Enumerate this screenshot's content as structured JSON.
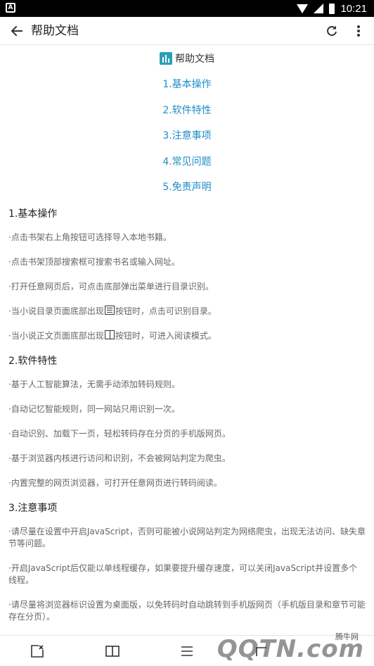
{
  "status_bar": {
    "time": "10:21",
    "left_badge": "A"
  },
  "app_bar": {
    "title": "帮助文档"
  },
  "toc": {
    "title": "帮助文档",
    "items": [
      "1.基本操作",
      "2.软件特性",
      "3.注意事项",
      "4.常见问题",
      "5.免责声明"
    ]
  },
  "sections": [
    {
      "heading": "1.基本操作",
      "paragraphs": [
        "·点击书架右上角按钮可选择导入本地书籍。",
        "·点击书架顶部搜索框可搜索书名或输入网址。",
        "·打开任意网页后，可点击底部弹出菜单进行目录识别。"
      ],
      "icon_para_1": {
        "before": "·当小说目录页面底部出现",
        "after": "按钮时，点击可识别目录。"
      },
      "icon_para_2": {
        "before": "·当小说正文页面底部出现",
        "after": "按钮时，可进入阅读模式。"
      }
    },
    {
      "heading": "2.软件特性",
      "paragraphs": [
        "·基于人工智能算法，无需手动添加转码规则。",
        "·自动记忆智能规则，同一网站只用识别一次。",
        "·自动识别、加载下一页，轻松转码存在分页的手机版网页。",
        "·基于浏览器内核进行访问和识别，不会被网站判定为爬虫。",
        "·内置完整的网页浏览器，可打开任意网页进行转码阅读。"
      ]
    },
    {
      "heading": "3.注意事项",
      "paragraphs": [
        "·请尽量在设置中开启JavaScript，否则可能被小说网站判定为网络爬虫，出现无法访问、缺失章节等问题。",
        "·开启JavaScript后仅能以单线程缓存，如果要提升缓存速度，可以关闭JavaScript并设置多个线程。",
        "·请尽量将浏览器标识设置为桌面版，以免转码时自动跳转到手机版网页（手机版目录和章节可能存在分页）。"
      ]
    }
  ],
  "watermark": {
    "text": "腾牛网",
    "logo": "QQTN.com"
  },
  "colors": {
    "link": "#1e8ec8",
    "logo": "#2a9fb5"
  }
}
